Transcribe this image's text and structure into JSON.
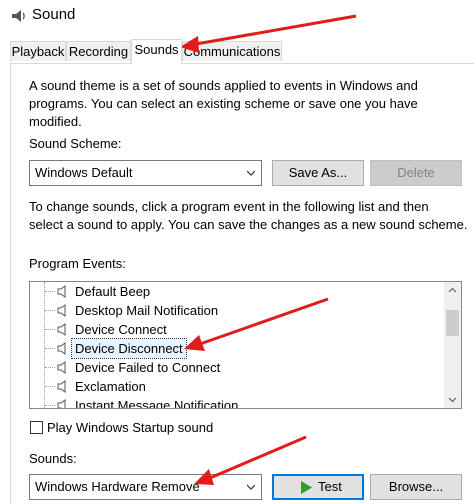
{
  "window": {
    "title": "Sound",
    "icon": "speaker-icon"
  },
  "tabs": [
    {
      "label": "Playback"
    },
    {
      "label": "Recording"
    },
    {
      "label": "Sounds"
    },
    {
      "label": "Communications"
    }
  ],
  "active_tab": "Sounds",
  "description": {
    "line1": "A sound theme is a set of sounds applied to events in Windows and",
    "line2": "programs.  You can select an existing scheme or save one you have",
    "line3": "modified."
  },
  "scheme": {
    "label": "Sound Scheme:",
    "value": "Windows Default",
    "save_as": "Save As...",
    "delete": "Delete"
  },
  "instructions": {
    "line1": "To change sounds, click a program event in the following list and then",
    "line2": "select a sound to apply.  You can save the changes as a new sound scheme."
  },
  "program_events": {
    "label": "Program Events:",
    "items": [
      {
        "label": "Default Beep"
      },
      {
        "label": "Desktop Mail Notification"
      },
      {
        "label": "Device Connect"
      },
      {
        "label": "Device Disconnect",
        "selected": true
      },
      {
        "label": "Device Failed to Connect"
      },
      {
        "label": "Exclamation"
      },
      {
        "label": "Instant Message Notification"
      }
    ]
  },
  "startup": {
    "label": "Play Windows Startup sound",
    "checked": false
  },
  "sounds": {
    "label": "Sounds:",
    "value": "Windows Hardware Remove",
    "test": "Test",
    "browse": "Browse..."
  },
  "colors": {
    "annotation_arrow": "#e31b1b",
    "accent": "#0078d7",
    "play_icon": "#2e9e2e"
  }
}
